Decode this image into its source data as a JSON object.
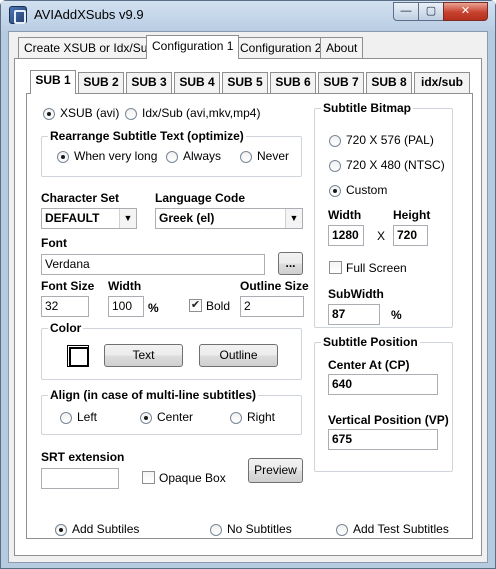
{
  "window": {
    "title": "AVIAddXSubs v9.9",
    "min": "—",
    "max": "▢",
    "close": "✕"
  },
  "main_tabs": [
    "Create XSUB or Idx/Sub",
    "Configuration 1",
    "Configuration 2",
    "About"
  ],
  "sub_tabs": [
    "SUB 1",
    "SUB 2",
    "SUB 3",
    "SUB 4",
    "SUB 5",
    "SUB 6",
    "SUB 7",
    "SUB 8",
    "idx/sub"
  ],
  "format": {
    "xsub": "XSUB (avi)",
    "idxsub": "Idx/Sub (avi,mkv,mp4)"
  },
  "rearrange": {
    "title": "Rearrange Subtitle Text (optimize)",
    "when_long": "When very long",
    "always": "Always",
    "never": "Never"
  },
  "charset": {
    "label": "Character Set",
    "value": "DEFAULT"
  },
  "language": {
    "label": "Language Code",
    "value": "Greek (el)"
  },
  "font": {
    "label": "Font",
    "value": "Verdana",
    "browse": "..."
  },
  "font_size": {
    "label": "Font Size",
    "value": "32"
  },
  "width": {
    "label": "Width",
    "value": "100",
    "unit": "%"
  },
  "bold": {
    "label": "Bold"
  },
  "outline_size": {
    "label": "Outline Size",
    "value": "2"
  },
  "color": {
    "title": "Color",
    "text_button": "Text",
    "outline_button": "Outline"
  },
  "align": {
    "title": "Align (in case of multi-line subtitles)",
    "left": "Left",
    "center": "Center",
    "right": "Right"
  },
  "srt": {
    "label": "SRT extension",
    "value": ""
  },
  "opaque": {
    "label": "Opaque Box"
  },
  "preview": {
    "label": "Preview"
  },
  "bitmap": {
    "title": "Subtitle Bitmap",
    "pal": "720 X 576 (PAL)",
    "ntsc": "720 X 480 (NTSC)",
    "custom": "Custom",
    "width_label": "Width",
    "width_value": "1280",
    "x": "X",
    "height_label": "Height",
    "height_value": "720",
    "fullscreen": "Full Screen",
    "subwidth_label": "SubWidth",
    "subwidth_value": "87",
    "subwidth_unit": "%"
  },
  "position": {
    "title": "Subtitle Position",
    "center_label": "Center At (CP)",
    "center_value": "640",
    "vertical_label": "Vertical Position (VP)",
    "vertical_value": "675"
  },
  "bottom": {
    "add": "Add Subtiles",
    "none": "No Subtitles",
    "test": "Add Test Subtitles"
  }
}
